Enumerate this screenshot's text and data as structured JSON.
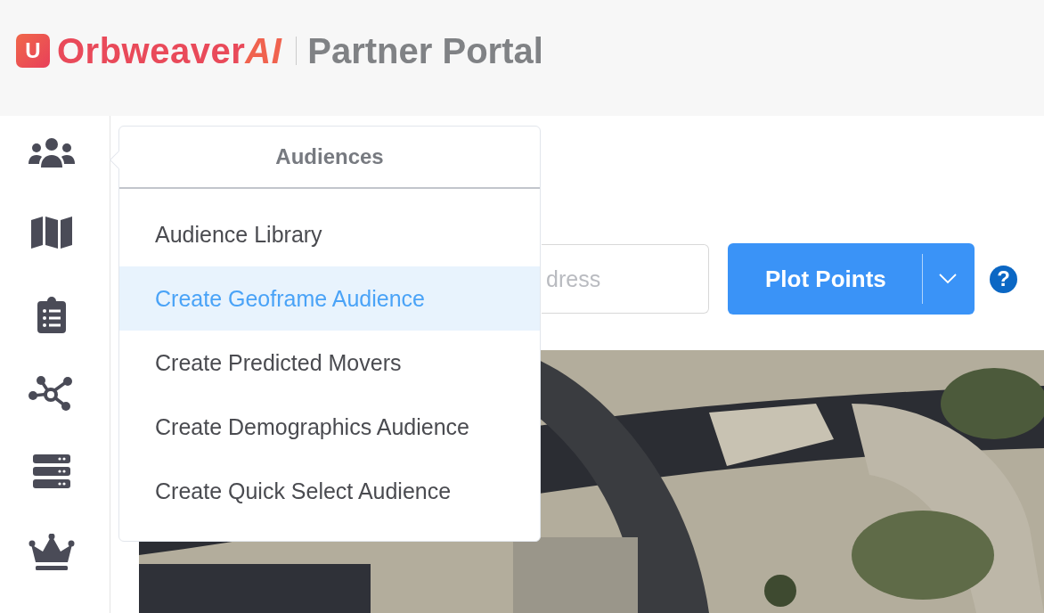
{
  "header": {
    "logo_mark": "U",
    "brand": "Orbweaver",
    "brand_suffix": "AI",
    "product": "Partner Portal"
  },
  "sidebar": {
    "items": [
      {
        "kind": "audiences"
      },
      {
        "kind": "map"
      },
      {
        "kind": "clipboard"
      },
      {
        "kind": "network"
      },
      {
        "kind": "server"
      },
      {
        "kind": "crown"
      }
    ]
  },
  "dropdown": {
    "title": "Audiences",
    "items": [
      {
        "label": "Audience Library",
        "selected": false
      },
      {
        "label": "Create Geoframe Audience",
        "selected": true
      },
      {
        "label": "Create Predicted Movers",
        "selected": false
      },
      {
        "label": "Create Demographics Audience",
        "selected": false
      },
      {
        "label": "Create Quick Select Audience",
        "selected": false
      }
    ]
  },
  "toolbar": {
    "address_placeholder": "dress",
    "plot_button": "Plot Points",
    "help": "?"
  }
}
